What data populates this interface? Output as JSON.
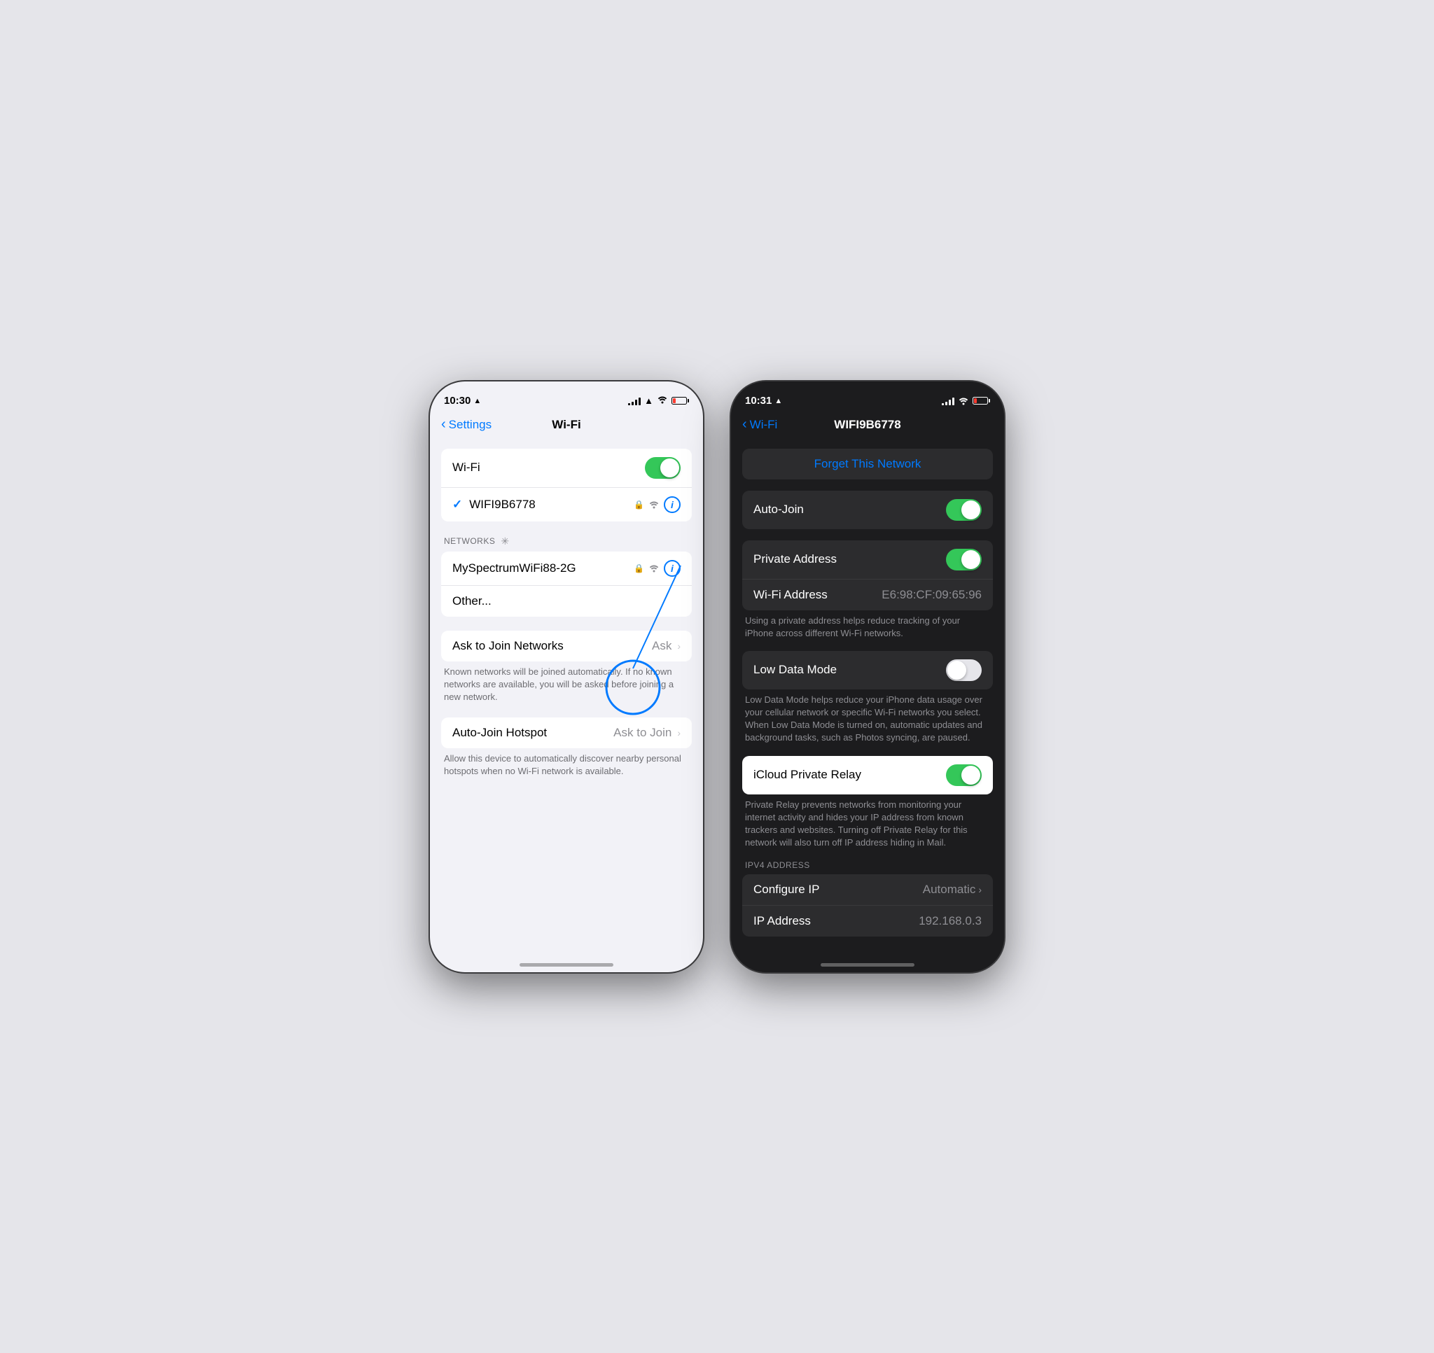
{
  "phone1": {
    "statusBar": {
      "time": "10:30",
      "location": "▲",
      "signalBars": [
        3,
        5,
        7,
        9,
        11
      ],
      "wifi": "wifi",
      "battery": "low"
    },
    "navBack": "Settings",
    "navTitle": "Wi-Fi",
    "wifiToggle": {
      "label": "Wi-Fi",
      "state": "on"
    },
    "connectedNetwork": {
      "name": "WIFI9B6778",
      "hasCheck": true,
      "hasLock": true,
      "hasWifi": true
    },
    "networksSection": {
      "header": "NETWORKS",
      "networks": [
        {
          "name": "MySpectrumWiFi88-2G",
          "hasLock": true,
          "hasWifi": true
        }
      ],
      "other": "Other..."
    },
    "askToJoin": {
      "label": "Ask to Join Networks",
      "value": "Ask",
      "description": "Known networks will be joined automatically. If no known networks are available, you will be asked before joining a new network."
    },
    "autoJoinHotspot": {
      "label": "Auto-Join Hotspot",
      "value": "Ask to Join",
      "description": "Allow this device to automatically discover nearby personal hotspots when no Wi-Fi network is available."
    }
  },
  "phone2": {
    "statusBar": {
      "time": "10:31",
      "location": "▲"
    },
    "navBack": "Wi-Fi",
    "navTitle": "WIFI9B6778",
    "forgetNetwork": "Forget This Network",
    "autoJoin": {
      "label": "Auto-Join",
      "state": "on"
    },
    "privateAddress": {
      "label": "Private Address",
      "state": "on"
    },
    "wifiAddress": {
      "label": "Wi-Fi Address",
      "value": "E6:98:CF:09:65:96",
      "description": "Using a private address helps reduce tracking of your iPhone across different Wi-Fi networks."
    },
    "lowDataMode": {
      "label": "Low Data Mode",
      "state": "off",
      "description": "Low Data Mode helps reduce your iPhone data usage over your cellular network or specific Wi-Fi networks you select. When Low Data Mode is turned on, automatic updates and background tasks, such as Photos syncing, are paused."
    },
    "iCloudPrivateRelay": {
      "label": "iCloud Private Relay",
      "state": "on",
      "description": "Private Relay prevents networks from monitoring your internet activity and hides your IP address from known trackers and websites. Turning off Private Relay for this network will also turn off IP address hiding in Mail."
    },
    "ipv4Section": {
      "header": "IPV4 ADDRESS",
      "configureIP": {
        "label": "Configure IP",
        "value": "Automatic"
      },
      "ipAddress": {
        "label": "IP Address",
        "value": "192.168.0.3"
      }
    }
  }
}
